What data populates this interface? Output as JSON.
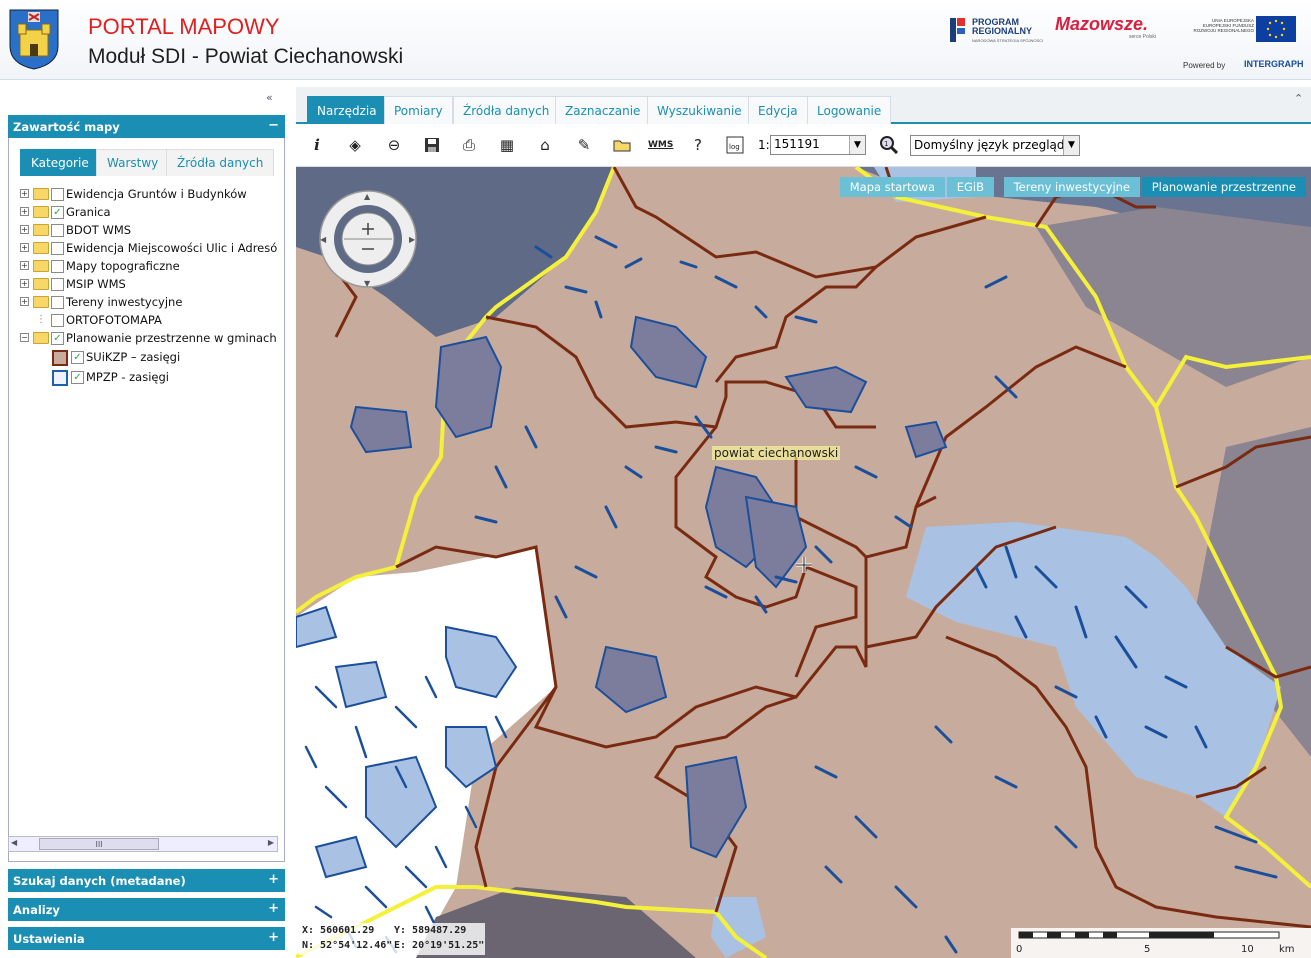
{
  "header": {
    "title_line1": "PORTAL MAPOWY",
    "title_line2": "Moduł SDI - Powiat Ciechanowski",
    "logo_program_regionalny": "PROGRAM REGIONALNY",
    "logo_program_sub": "NARODOWA STRATEGIA SPÓJNOŚCI",
    "logo_mazowsze": "Mazowsze.",
    "logo_mazowsze_sub": "serce Polski",
    "logo_ue": "UNIA EUROPEJSKA EUROPEJSKI FUNDUSZ ROZWOJU REGIONALNEGO",
    "powered_by": "Powered by",
    "intergraph": "INTERGRAPH"
  },
  "left_panel": {
    "collapse_icon": "«",
    "content_title": "Zawartość mapy",
    "content_toggle": "−",
    "subtabs": [
      "Kategorie",
      "Warstwy",
      "Źródła danych"
    ],
    "active_subtab": 0,
    "tree": [
      {
        "label": "Ewidencja Gruntów i Budynków",
        "expander": "+",
        "checked": false,
        "folder": true
      },
      {
        "label": "Granica",
        "expander": "+",
        "checked": true,
        "folder": true
      },
      {
        "label": "BDOT WMS",
        "expander": "+",
        "checked": false,
        "folder": true
      },
      {
        "label": "Ewidencja Miejscowości Ulic i Adresó",
        "expander": "+",
        "checked": false,
        "folder": true
      },
      {
        "label": "Mapy topograficzne",
        "expander": "+",
        "checked": false,
        "folder": true
      },
      {
        "label": "MSIP WMS",
        "expander": "+",
        "checked": false,
        "folder": true
      },
      {
        "label": "Tereny inwestycyjne",
        "expander": "+",
        "checked": false,
        "folder": true
      },
      {
        "label": "ORTOFOTOMAPA",
        "expander": "",
        "checked": false,
        "folder": false
      },
      {
        "label": "Planowanie przestrzenne w gminach",
        "expander": "−",
        "checked": true,
        "folder": true
      }
    ],
    "legend": [
      {
        "label": "SUiKZP – zasięgi",
        "checked": true,
        "color": "#7a2a10"
      },
      {
        "label": "MPZP - zasięgi",
        "checked": true,
        "color": "#1f5fb0"
      }
    ],
    "scroll_thumb": "III",
    "sections": [
      {
        "title": "Szukaj danych (metadane)",
        "toggle": "+"
      },
      {
        "title": "Analizy",
        "toggle": "+"
      },
      {
        "title": "Ustawienia",
        "toggle": "+"
      }
    ]
  },
  "tabs": [
    "Narzędzia",
    "Pomiary",
    "Źródła danych",
    "Zaznaczanie",
    "Wyszukiwanie",
    "Edycja",
    "Logowanie"
  ],
  "active_tab": 0,
  "collapse_top_icon": "«",
  "toolbar": {
    "icons": [
      "info-icon",
      "3d-view-icon",
      "zoom-out-icon",
      "save-icon",
      "print-icon",
      "table-icon",
      "home-icon",
      "pencil-icon",
      "folder-open-icon",
      "wms-icon",
      "help-icon",
      "log-icon"
    ],
    "glyphs": [
      "i",
      "◈",
      "⊖",
      "💾",
      "⎙",
      "▦",
      "⌂",
      "✎",
      "📂",
      "▤",
      "?",
      "≣"
    ],
    "scale_prefix": "1:",
    "scale_value": "151191",
    "language_value": "Domyślny język przeglądarki"
  },
  "map": {
    "layer_buttons": [
      "Mapa startowa",
      "EGiB",
      "Tereny inwestycyjne",
      "Planowanie przestrzenne"
    ],
    "active_layer_button": 3,
    "feature_label": "powiat ciechanowski",
    "coords": {
      "x": "X: 560601.29",
      "y": "Y: 589487.29",
      "n": "N: 52°54'12.46\"",
      "e": "E: 20°19'51.25\""
    },
    "scalebar": {
      "labels": [
        "0",
        "5",
        "10"
      ],
      "unit": "km"
    },
    "colors": {
      "gmina_fill": "#c7ac9e",
      "outside_dark": "#5e6a86",
      "outside_mid": "#8a8591",
      "gmina_border": "#7a2a10",
      "powiat_border": "#f5f03a",
      "mpzp_fill": "#7c7d9c",
      "mpzp_stroke": "#1b4f9c",
      "light_blue": "#a9c2e4",
      "white_gmina": "#ffffff"
    }
  }
}
